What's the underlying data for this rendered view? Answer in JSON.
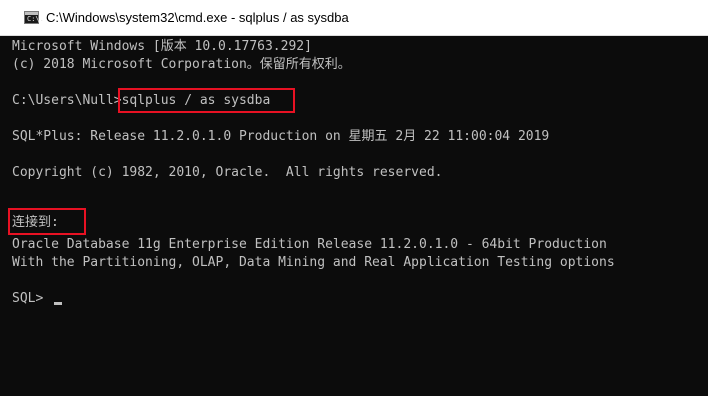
{
  "window": {
    "title": "C:\\Windows\\system32\\cmd.exe - sqlplus  / as sysdba",
    "icon": "cmd-icon",
    "icon_glyph": "C:\\."
  },
  "console": {
    "background": "#0c0c0c",
    "text_color": "#c0c0c0",
    "highlight_color": "#e81123",
    "lines": [
      "Microsoft Windows [版本 10.0.17763.292]",
      "(c) 2018 Microsoft Corporation。保留所有权利。",
      "",
      "C:\\Users\\Null>",
      "SQL*Plus: Release 11.2.0.1.0 Production on 星期五 2月 22 11:00:04 2019",
      "Copyright (c) 1982, 2010, Oracle.  All rights reserved.",
      "连接到:",
      "Oracle Database 11g Enterprise Edition Release 11.2.0.1.0 - 64bit Production",
      "With the Partitioning, OLAP, Data Mining and Real Application Testing options",
      "SQL> "
    ],
    "typed_command": "sqlplus / as sysdba",
    "highlighted_texts": [
      "sqlplus / as sysdba",
      "连接到:"
    ]
  }
}
